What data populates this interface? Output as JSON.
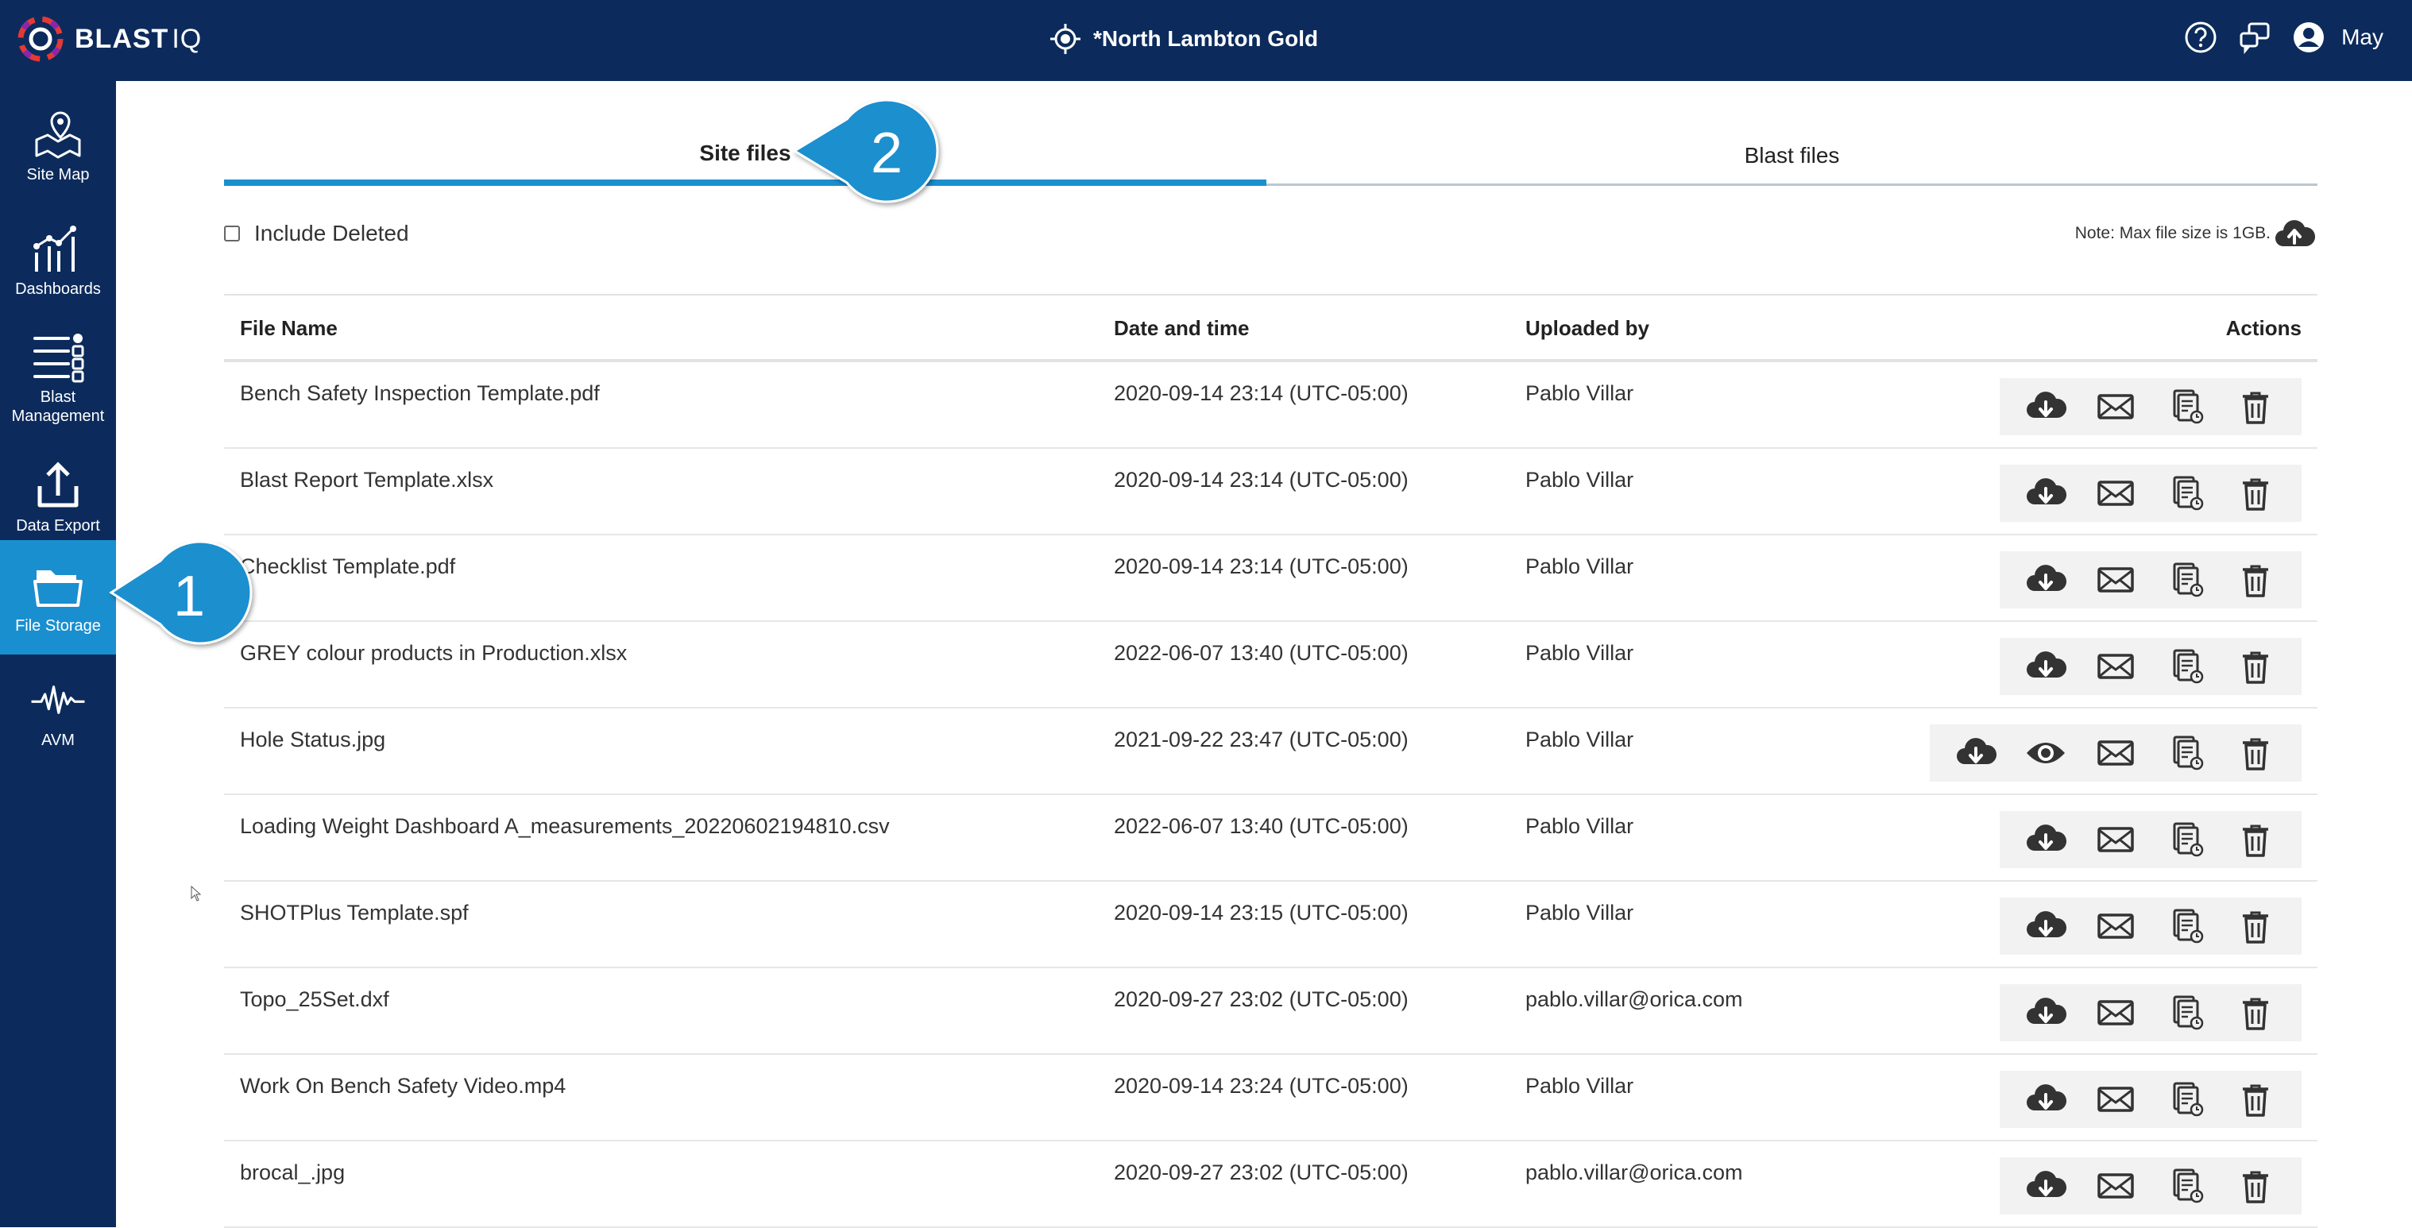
{
  "header": {
    "brand_main": "BLAST",
    "brand_suffix": "IQ",
    "site_name": "*North Lambton Gold",
    "user_name": "May",
    "icons": [
      "help-icon",
      "chat-icon",
      "user-icon",
      "location-target-icon"
    ]
  },
  "sidebar": {
    "items": [
      {
        "label": "Site Map",
        "icon": "map-pin-icon",
        "active": false
      },
      {
        "label": "Dashboards",
        "icon": "chart-icon",
        "active": false
      },
      {
        "label": "Blast Management",
        "icon": "list-icon",
        "active": false
      },
      {
        "label": "Data Export",
        "icon": "upload-icon",
        "active": false
      },
      {
        "label": "File Storage",
        "icon": "folder-icon",
        "active": true
      },
      {
        "label": "AVM",
        "icon": "waveform-icon",
        "active": false
      }
    ]
  },
  "tabs": [
    {
      "label": "Site files",
      "active": true
    },
    {
      "label": "Blast files",
      "active": false
    }
  ],
  "options": {
    "include_deleted_label": "Include Deleted",
    "include_deleted_checked": false,
    "note": "Note: Max file size is 1GB."
  },
  "table": {
    "columns": [
      "File Name",
      "Date and time",
      "Uploaded by",
      "Actions"
    ],
    "rows": [
      {
        "name": "Bench Safety Inspection Template.pdf",
        "date": "2020-09-14 23:14 (UTC-05:00)",
        "user": "Pablo Villar",
        "preview": false
      },
      {
        "name": "Blast Report Template.xlsx",
        "date": "2020-09-14 23:14 (UTC-05:00)",
        "user": "Pablo Villar",
        "preview": false
      },
      {
        "name": "Checklist Template.pdf",
        "date": "2020-09-14 23:14 (UTC-05:00)",
        "user": "Pablo Villar",
        "preview": false
      },
      {
        "name": "GREY colour products in Production.xlsx",
        "date": "2022-06-07 13:40 (UTC-05:00)",
        "user": "Pablo Villar",
        "preview": false
      },
      {
        "name": "Hole Status.jpg",
        "date": "2021-09-22 23:47 (UTC-05:00)",
        "user": "Pablo Villar",
        "preview": true
      },
      {
        "name": "Loading Weight Dashboard A_measurements_20220602194810.csv",
        "date": "2022-06-07 13:40 (UTC-05:00)",
        "user": "Pablo Villar",
        "preview": false
      },
      {
        "name": "SHOTPlus Template.spf",
        "date": "2020-09-14 23:15 (UTC-05:00)",
        "user": "Pablo Villar",
        "preview": false
      },
      {
        "name": "Topo_25Set.dxf",
        "date": "2020-09-27 23:02 (UTC-05:00)",
        "user": "pablo.villar@orica.com",
        "preview": false
      },
      {
        "name": "Work On Bench Safety Video.mp4",
        "date": "2020-09-14 23:24 (UTC-05:00)",
        "user": "Pablo Villar",
        "preview": false
      },
      {
        "name": "brocal_.jpg",
        "date": "2020-09-27 23:02 (UTC-05:00)",
        "user": "pablo.villar@orica.com",
        "preview": false
      }
    ]
  },
  "callouts": [
    {
      "number": "1"
    },
    {
      "number": "2"
    }
  ],
  "colors": {
    "navy": "#0c2b5c",
    "accent": "#1a8fcf",
    "callout": "#1b8fcf"
  }
}
